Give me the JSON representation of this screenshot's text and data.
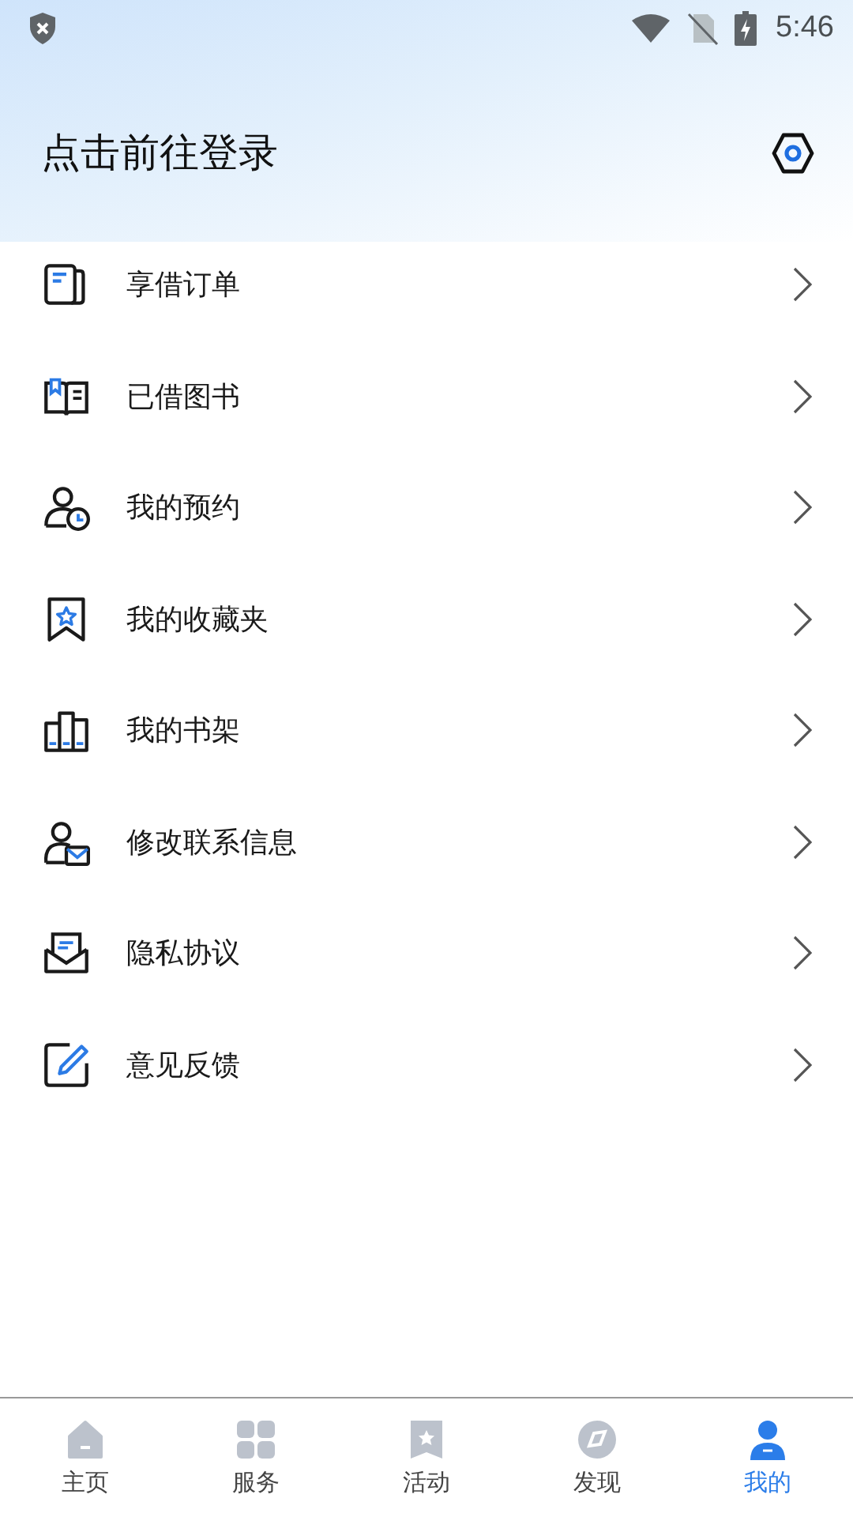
{
  "status_bar": {
    "time": "5:46"
  },
  "header": {
    "title": "点击前往登录"
  },
  "menu": [
    {
      "label": "享借订单"
    },
    {
      "label": "已借图书"
    },
    {
      "label": "我的预约"
    },
    {
      "label": "我的收藏夹"
    },
    {
      "label": "我的书架"
    },
    {
      "label": "修改联系信息"
    },
    {
      "label": "隐私协议"
    },
    {
      "label": "意见反馈"
    }
  ],
  "tab_bar": [
    {
      "label": "主页",
      "selected": false
    },
    {
      "label": "服务",
      "selected": false
    },
    {
      "label": "活动",
      "selected": false
    },
    {
      "label": "发现",
      "selected": false
    },
    {
      "label": "我的",
      "selected": true
    }
  ]
}
